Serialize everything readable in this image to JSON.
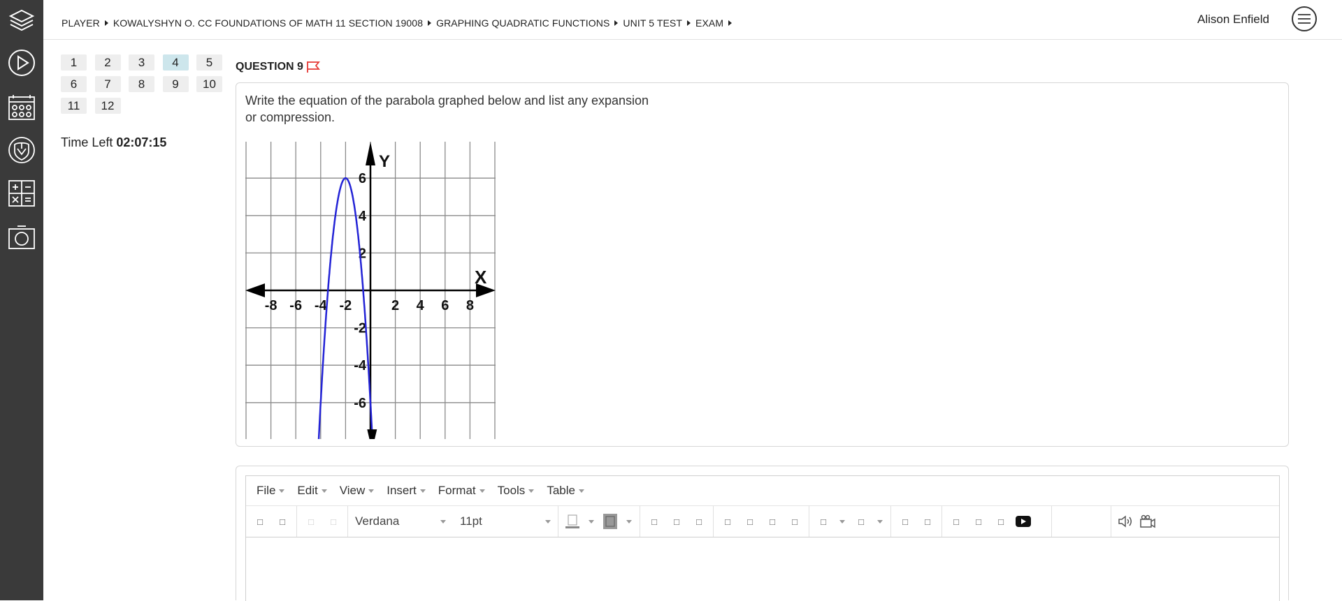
{
  "breadcrumb": [
    "PLAYER",
    "KOWALYSHYN O. CC FOUNDATIONS OF MATH 11 SECTION 19008",
    "GRAPHING QUADRATIC FUNCTIONS",
    "UNIT 5 TEST",
    "EXAM"
  ],
  "user": {
    "name": "Alison Enfield"
  },
  "question_nav": {
    "numbers": [
      "1",
      "2",
      "3",
      "4",
      "5",
      "6",
      "7",
      "8",
      "9",
      "10",
      "11",
      "12"
    ],
    "active": "4"
  },
  "timer": {
    "label": "Time Left",
    "value": "02:07:15"
  },
  "question": {
    "title": "QUESTION 9",
    "text_line1": "Write the equation of the parabola graphed below and list any expansion",
    "text_line2": "or compression."
  },
  "graph": {
    "axis_x": "X",
    "axis_y": "Y",
    "x_tick_labels": [
      "-8",
      "-6",
      "-4",
      "-2",
      "2",
      "4",
      "6",
      "8"
    ],
    "y_tick_labels": [
      "6",
      "4",
      "2",
      "-2",
      "-4",
      "-6"
    ],
    "curve_color": "#2323d6",
    "vertex": [
      -2,
      6
    ],
    "x_range": [
      -10,
      10
    ],
    "y_range": [
      -8,
      8
    ]
  },
  "editor": {
    "menus": [
      "File",
      "Edit",
      "View",
      "Insert",
      "Format",
      "Tools",
      "Table"
    ],
    "font_family": "Verdana",
    "font_size": "11pt"
  },
  "colors": {
    "rail": "#3a3a3a",
    "flag": "#e53935",
    "active_question": "#cde6ec"
  }
}
